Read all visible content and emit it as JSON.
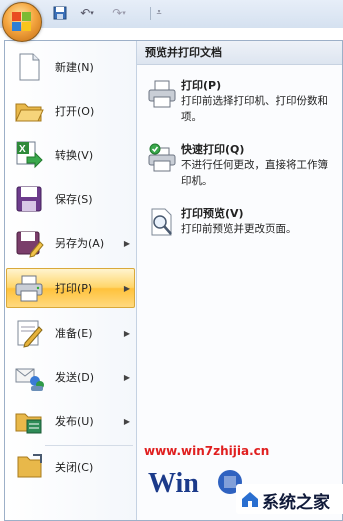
{
  "quick_access": {
    "save_icon": "save-icon",
    "undo_icon": "undo-icon",
    "redo_icon": "redo-icon",
    "customize_icon": "customize-icon"
  },
  "menu": {
    "items": [
      {
        "label": "新建(N)",
        "icon": "new-document-icon",
        "has_submenu": false
      },
      {
        "label": "打开(O)",
        "icon": "open-folder-icon",
        "has_submenu": false
      },
      {
        "label": "转换(V)",
        "icon": "convert-icon",
        "has_submenu": false
      },
      {
        "label": "保存(S)",
        "icon": "save-icon",
        "has_submenu": false
      },
      {
        "label": "另存为(A)",
        "icon": "save-as-icon",
        "has_submenu": true
      },
      {
        "label": "打印(P)",
        "icon": "print-icon",
        "has_submenu": true,
        "active": true
      },
      {
        "label": "准备(E)",
        "icon": "prepare-icon",
        "has_submenu": true
      },
      {
        "label": "发送(D)",
        "icon": "send-icon",
        "has_submenu": true
      },
      {
        "label": "发布(U)",
        "icon": "publish-icon",
        "has_submenu": true
      },
      {
        "label": "关闭(C)",
        "icon": "close-document-icon",
        "has_submenu": false
      }
    ],
    "arrow_glyph": "▶"
  },
  "submenu": {
    "title": "预览并打印文档",
    "items": [
      {
        "title": "打印(P)",
        "desc_line1": "打印前选择打印机、打印份数和",
        "desc_line2": "项。",
        "icon": "printer-icon"
      },
      {
        "title": "快速打印(Q)",
        "desc_line1": "不进行任何更改，直接将工作簿",
        "desc_line2": "印机。",
        "icon": "quick-print-icon"
      },
      {
        "title": "打印预览(V)",
        "desc_line1": "打印前预览并更改页面。",
        "desc_line2": "",
        "icon": "print-preview-icon"
      }
    ]
  },
  "watermark": {
    "url": "www.win7zhijia.cn",
    "site_name": "系统之家"
  }
}
